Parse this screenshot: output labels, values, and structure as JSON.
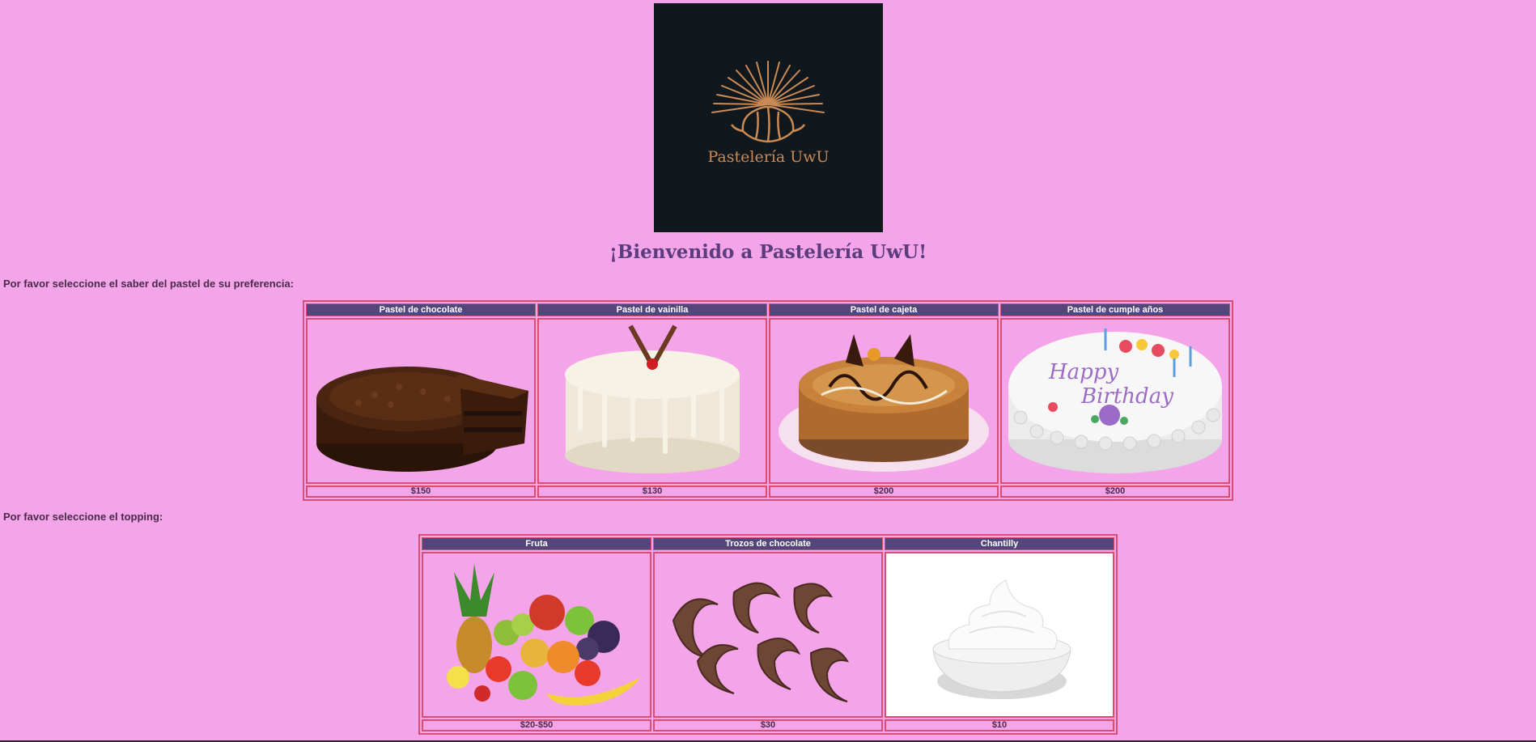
{
  "logo": {
    "brand": "Pastelería UwU",
    "colors": {
      "bg": "#10171d",
      "accent": "#c98a55"
    }
  },
  "welcome": "¡Bienvenido a Pastelería UwU!",
  "cakes": {
    "prompt": "Por favor seleccione el saber del pastel de su preferencia:",
    "items": [
      {
        "name": "Pastel de chocolate",
        "price": "$150",
        "image": "chocolate-cake"
      },
      {
        "name": "Pastel de vainilla",
        "price": "$130",
        "image": "vanilla-cake"
      },
      {
        "name": "Pastel de cajeta",
        "price": "$200",
        "image": "cajeta-cake"
      },
      {
        "name": "Pastel de cumple años",
        "price": "$200",
        "image": "birthday-cake"
      }
    ]
  },
  "toppings": {
    "prompt": "Por favor seleccione el topping:",
    "items": [
      {
        "name": "Fruta",
        "price": "$20-$50",
        "image": "fruit"
      },
      {
        "name": "Trozos de chocolate",
        "price": "$30",
        "image": "chocolate-curls"
      },
      {
        "name": "Chantilly",
        "price": "$10",
        "image": "whipped-cream"
      }
    ]
  },
  "colors": {
    "page": "#f4a4e8",
    "header": "#54457a",
    "border": "#d94f72",
    "title": "#5b3c7c"
  }
}
